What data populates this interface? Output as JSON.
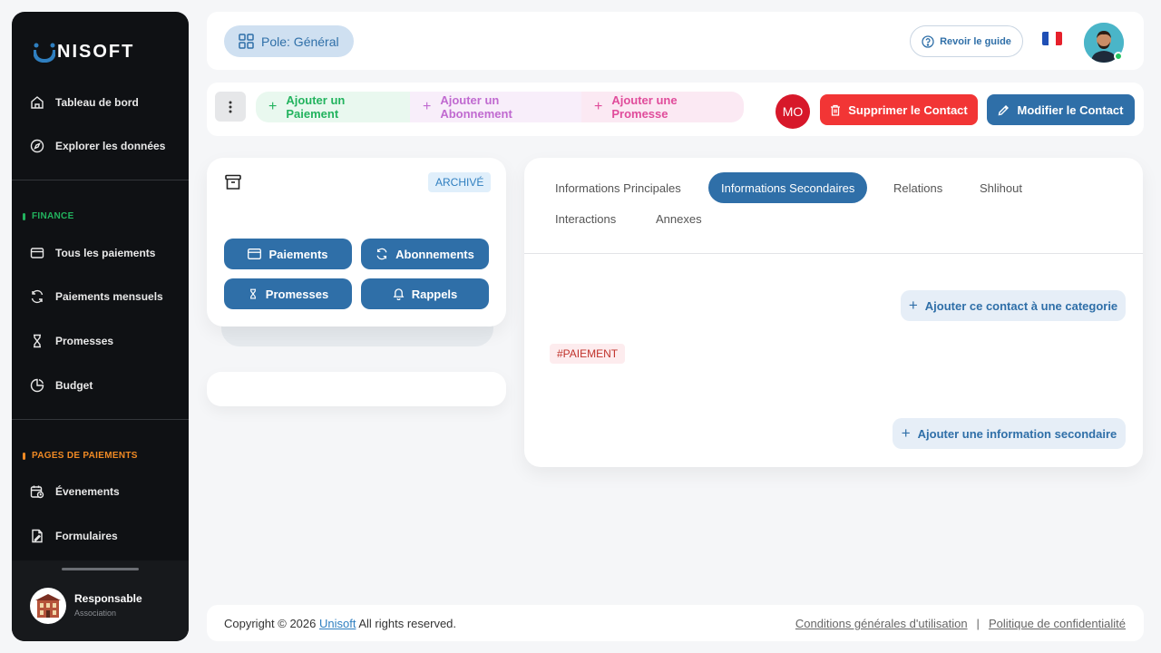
{
  "sidebar": {
    "logo": "NISOFT",
    "items": [
      {
        "label": "Tableau de bord",
        "icon": "home-icon"
      },
      {
        "label": "Explorer les données",
        "icon": "compass-icon"
      }
    ],
    "sections": [
      {
        "title": "FINANCE",
        "color": "#22b35e",
        "items": [
          {
            "label": "Tous les paiements",
            "icon": "credit-card-icon"
          },
          {
            "label": "Paiements mensuels",
            "icon": "refresh-icon"
          },
          {
            "label": "Promesses",
            "icon": "hourglass-icon"
          },
          {
            "label": "Budget",
            "icon": "pie-chart-icon"
          }
        ]
      },
      {
        "title": "PAGES DE PAIEMENTS",
        "color": "#f08a24",
        "items": [
          {
            "label": "Évenements",
            "icon": "calendar-clock-icon"
          },
          {
            "label": "Formulaires",
            "icon": "form-icon"
          }
        ]
      }
    ],
    "profile": {
      "name": "Responsable",
      "role": "Association"
    }
  },
  "header": {
    "pole_label": "Pole: Général",
    "guide_label": "Revoir le guide"
  },
  "actions": {
    "add_payment": "Ajouter un Paiement",
    "add_subscription": "Ajouter un Abonnement",
    "add_promise": "Ajouter une Promesse",
    "initials": "MO",
    "delete_contact": "Supprimer le Contact",
    "edit_contact": "Modifier le Contact"
  },
  "contact_card": {
    "badge": "ARCHIVÉ",
    "buttons": [
      "Paiements",
      "Abonnements",
      "Promesses",
      "Rappels"
    ]
  },
  "details": {
    "tabs": [
      "Informations Principales",
      "Informations Secondaires",
      "Relations",
      "Shlihout",
      "Interactions",
      "Annexes"
    ],
    "active_tab": "Informations Secondaires",
    "add_category": "Ajouter ce contact à une categorie",
    "tag": "#PAIEMENT",
    "add_secondary": "Ajouter une information secondaire"
  },
  "footer": {
    "copyright": "Copyright © 2026",
    "brand": "Unisoft",
    "rights": "All rights reserved.",
    "terms": "Conditions générales d'utilisation",
    "separator": "|",
    "privacy": "Politique de confidentialité"
  }
}
